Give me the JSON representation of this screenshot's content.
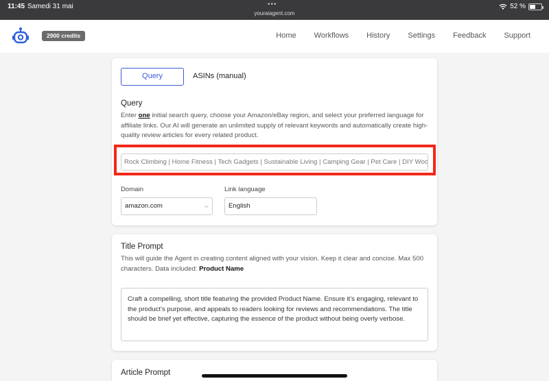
{
  "status_bar": {
    "time": "11:45",
    "date": "Samedi 31 mai",
    "url": "youraiagent.com",
    "battery": "52 %",
    "battery_level": 0.52
  },
  "header": {
    "logo_icon": "robot-icon",
    "credits": "2900 credits",
    "nav": [
      "Home",
      "Workflows",
      "History",
      "Settings",
      "Feedback",
      "Support"
    ]
  },
  "query_card": {
    "tabs": [
      "Query",
      "ASINs (manual)"
    ],
    "title": "Query",
    "desc_pre": "Enter ",
    "desc_bold": "one",
    "desc_post": " initial search query, choose your Amazon/eBay region, and select your preferred language for affiliate links. Our AI will generate an unlimited supply of relevant keywords and automatically create high-quality review articles for every related product.",
    "query_placeholder": "Rock Climbing | Home Fitness | Tech Gadgets | Sustainable Living | Camping Gear | Pet Care | DIY Woodworking",
    "domain_label": "Domain",
    "domain_value": "amazon.com",
    "language_label": "Link language",
    "language_value": "English"
  },
  "title_prompt_card": {
    "title": "Title Prompt",
    "desc": "This will guide the Agent in creating content aligned with your vision. Keep it clear and concise. Max 500 characters. Data included: ",
    "desc_bold": "Product Name",
    "value": "Craft a compelling, short title featuring the provided Product Name. Ensure it’s engaging, relevant to the product’s purpose, and appeals to readers looking for reviews and recommendations. The title should be brief yet effective, capturing the essence of the product without being overly verbose."
  },
  "article_prompt_card": {
    "title": "Article Prompt"
  },
  "colors": {
    "accent": "#3b5bdb",
    "highlight": "#f3271a"
  }
}
